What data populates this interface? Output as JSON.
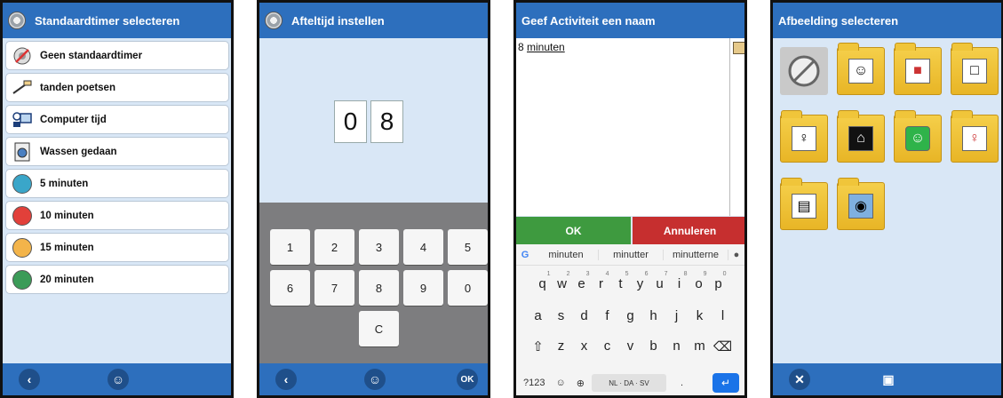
{
  "screen1": {
    "title": "Standaardtimer selecteren",
    "items": [
      {
        "label": "Geen standaardtimer",
        "icon": "no-timer-icon"
      },
      {
        "label": "tanden poetsen",
        "icon": "toothbrush-icon"
      },
      {
        "label": "Computer tijd",
        "icon": "computer-icon"
      },
      {
        "label": "Wassen gedaan",
        "icon": "washing-machine-icon"
      },
      {
        "label": "5 minuten",
        "icon": "blue-dot-icon",
        "color": "#3aa6c9"
      },
      {
        "label": "10 minuten",
        "icon": "red-dot-icon",
        "color": "#e2403a"
      },
      {
        "label": "15 minuten",
        "icon": "orange-dot-icon",
        "color": "#f3b44a"
      },
      {
        "label": "20 minuten",
        "icon": "green-dot-icon",
        "color": "#3b9b58"
      }
    ],
    "bottom": {
      "back_icon": "chevron-left-icon",
      "profile_icon": "user-icon"
    }
  },
  "screen2": {
    "title": "Afteltijd instellen",
    "digits": [
      "0",
      "8"
    ],
    "keys": [
      "1",
      "2",
      "3",
      "4",
      "5",
      "6",
      "7",
      "8",
      "9",
      "0",
      "C"
    ],
    "ok_label": "OK"
  },
  "screen3": {
    "title": "Geef Activiteit een naam",
    "text_value_prefix": "8 ",
    "text_value_underlined": "minuten",
    "ok_label": "OK",
    "cancel_label": "Annuleren",
    "suggestions": [
      "minuten",
      "minutter",
      "minutterne"
    ],
    "row1": [
      "q",
      "w",
      "e",
      "r",
      "t",
      "y",
      "u",
      "i",
      "o",
      "p"
    ],
    "row1_numbers": [
      "1",
      "2",
      "3",
      "4",
      "5",
      "6",
      "7",
      "8",
      "9",
      "0"
    ],
    "row2": [
      "a",
      "s",
      "d",
      "f",
      "g",
      "h",
      "j",
      "k",
      "l"
    ],
    "row3": [
      "z",
      "x",
      "c",
      "v",
      "b",
      "n",
      "m"
    ],
    "numbers_key": "?123",
    "lang_key": "NL · DA · SV",
    "period_key": "."
  },
  "screen4": {
    "title": "Afbeelding selecteren"
  }
}
